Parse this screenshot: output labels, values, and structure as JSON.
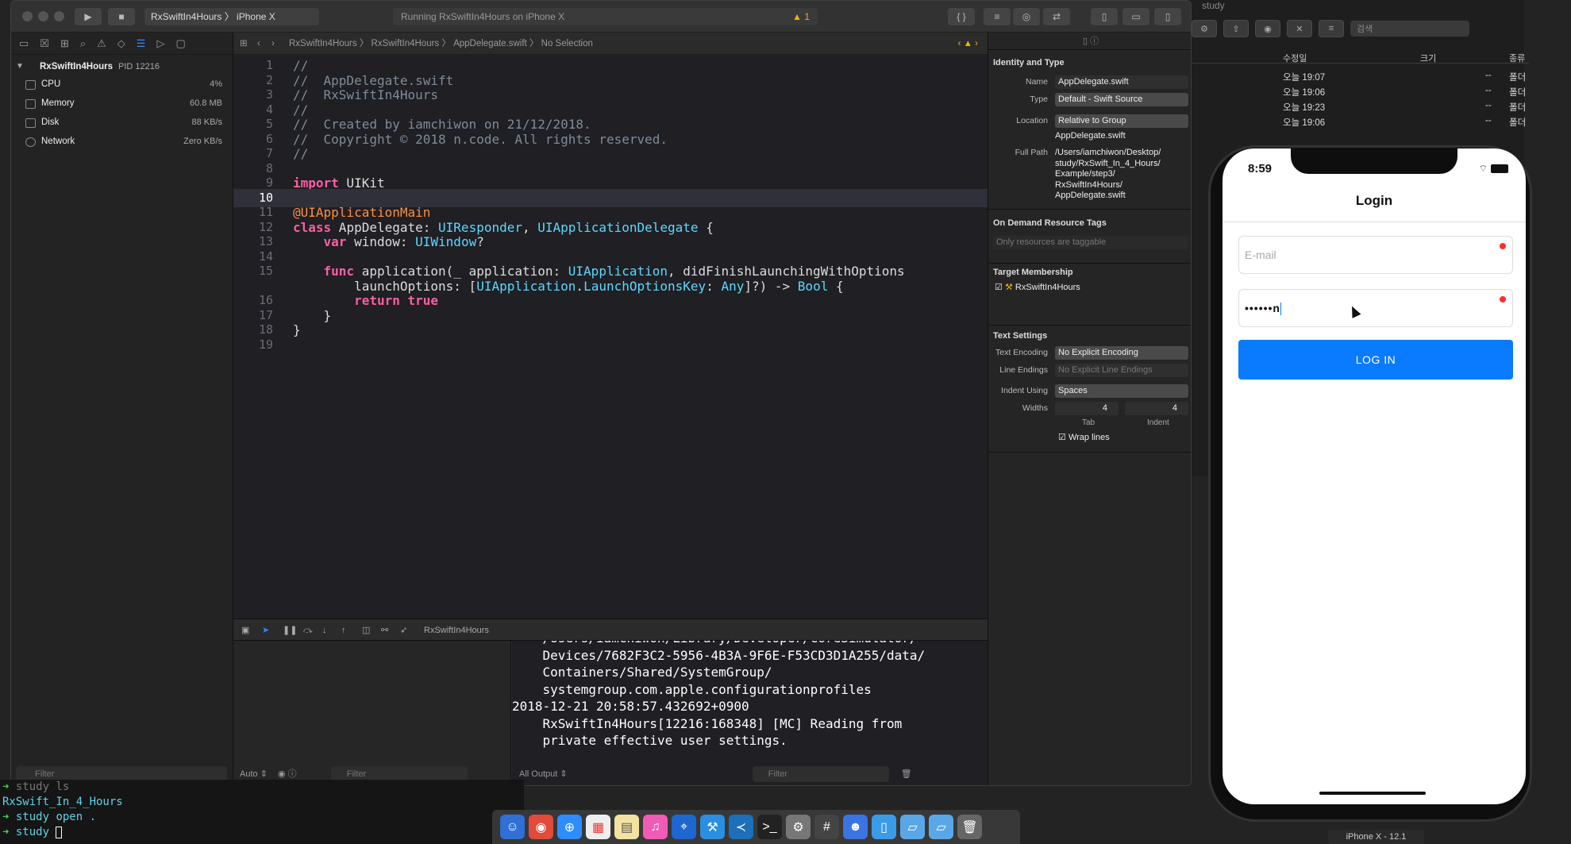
{
  "finder": {
    "title": "study",
    "headers": {
      "modified": "수정일",
      "size": "크기",
      "kind": "종류"
    },
    "rows": [
      {
        "modified": "오늘 19:07",
        "size": "--",
        "kind": "폴더"
      },
      {
        "modified": "오늘 19:06",
        "size": "--",
        "kind": "폴더"
      },
      {
        "modified": "오늘 19:23",
        "size": "--",
        "kind": "폴더"
      },
      {
        "modified": "오늘 19:06",
        "size": "--",
        "kind": "폴더"
      }
    ],
    "search_placeholder": "검색"
  },
  "xcode": {
    "toolbar": {
      "scheme": "RxSwiftIn4Hours",
      "device": "iPhone X",
      "activity": "Running RxSwiftIn4Hours on iPhone X",
      "warning_count": "1"
    },
    "jumpbar": {
      "project": "RxSwiftIn4Hours",
      "group": "RxSwiftIn4Hours",
      "file": "AppDelegate.swift",
      "selection": "No Selection"
    },
    "navigator": {
      "process": "RxSwiftIn4Hours",
      "pid": "PID 12216",
      "gauges": [
        {
          "label": "CPU",
          "value": "4%"
        },
        {
          "label": "Memory",
          "value": "60.8 MB"
        },
        {
          "label": "Disk",
          "value": "88 KB/s"
        },
        {
          "label": "Network",
          "value": "Zero KB/s"
        }
      ],
      "filter_placeholder": "Filter"
    },
    "editor": {
      "current_line": "10",
      "lines": [
        {
          "n": "1",
          "t": "//",
          "c": "cmt"
        },
        {
          "n": "2",
          "t": "//  AppDelegate.swift",
          "c": "cmt"
        },
        {
          "n": "3",
          "t": "//  RxSwiftIn4Hours",
          "c": "cmt"
        },
        {
          "n": "4",
          "t": "//",
          "c": "cmt"
        },
        {
          "n": "5",
          "t": "//  Created by iamchiwon on 21/12/2018.",
          "c": "cmt"
        },
        {
          "n": "6",
          "t": "//  Copyright © 2018 n.code. All rights reserved.",
          "c": "cmt"
        },
        {
          "n": "7",
          "t": "//",
          "c": "cmt"
        },
        {
          "n": "8",
          "t": "",
          "c": ""
        },
        {
          "n": "9",
          "t": "import UIKit",
          "c": "import"
        },
        {
          "n": "10",
          "t": "",
          "c": ""
        },
        {
          "n": "11",
          "t": "@UIApplicationMain",
          "c": "attr"
        },
        {
          "n": "12",
          "t": "class AppDelegate: UIResponder, UIApplicationDelegate {",
          "c": "class"
        },
        {
          "n": "13",
          "t": "    var window: UIWindow?",
          "c": "var"
        },
        {
          "n": "14",
          "t": "",
          "c": ""
        },
        {
          "n": "15",
          "t": "    func application(_ application: UIApplication, didFinishLaunchingWithOptions",
          "c": "func"
        },
        {
          "n": "",
          "t": "        launchOptions: [UIApplication.LaunchOptionsKey: Any]?) -> Bool {",
          "c": "cont"
        },
        {
          "n": "16",
          "t": "        return true",
          "c": "ret"
        },
        {
          "n": "17",
          "t": "    }",
          "c": ""
        },
        {
          "n": "18",
          "t": "}",
          "c": ""
        },
        {
          "n": "19",
          "t": "",
          "c": ""
        }
      ]
    },
    "debug": {
      "target": "RxSwiftIn4Hours",
      "auto_label": "Auto",
      "filter_placeholder": "Filter",
      "output_label": "All Output"
    },
    "console_lines": [
      "    /Users/iamchiwon/Library/Developer/CoreSimulator/",
      "    Devices/7682F3C2-5956-4B3A-9F6E-F53CD3D1A255/data/",
      "    Containers/Shared/SystemGroup/",
      "    systemgroup.com.apple.configurationprofiles",
      "2018-12-21 20:58:57.432692+0900",
      "    RxSwiftIn4Hours[12216:168348] [MC] Reading from",
      "    private effective user settings."
    ],
    "inspector": {
      "identity_header": "Identity and Type",
      "name_label": "Name",
      "name_value": "AppDelegate.swift",
      "type_label": "Type",
      "type_value": "Default - Swift Source",
      "location_label": "Location",
      "location_value": "Relative to Group",
      "location_file": "AppDelegate.swift",
      "fullpath_label": "Full Path",
      "fullpath_lines": [
        "/Users/iamchiwon/Desktop/",
        "study/RxSwift_In_4_Hours/",
        "Example/step3/",
        "RxSwiftIn4Hours/",
        "AppDelegate.swift"
      ],
      "ondemand_header": "On Demand Resource Tags",
      "ondemand_placeholder": "Only resources are taggable",
      "target_header": "Target Membership",
      "target_name": "RxSwiftIn4Hours",
      "text_header": "Text Settings",
      "encoding_label": "Text Encoding",
      "encoding_value": "No Explicit Encoding",
      "endings_label": "Line Endings",
      "endings_value": "No Explicit Line Endings",
      "indent_label": "Indent Using",
      "indent_value": "Spaces",
      "widths_label": "Widths",
      "tab_value": "4",
      "indent_width_value": "4",
      "tab_caption": "Tab",
      "indent_caption": "Indent",
      "wrap_label": "Wrap lines"
    }
  },
  "terminal": {
    "lines": [
      {
        "prompt": "",
        "text": "study ls"
      },
      {
        "prompt": "",
        "text": "RxSwift_In_4_Hours"
      },
      {
        "prompt": "➜",
        "text": "study open ."
      },
      {
        "prompt": "➜",
        "text": "study"
      }
    ]
  },
  "simulator": {
    "time": "8:59",
    "title": "Login",
    "email_placeholder": "E-mail",
    "password_value": "••••••n",
    "login_label": "LOG IN",
    "device_label": "iPhone X - 12.1"
  }
}
